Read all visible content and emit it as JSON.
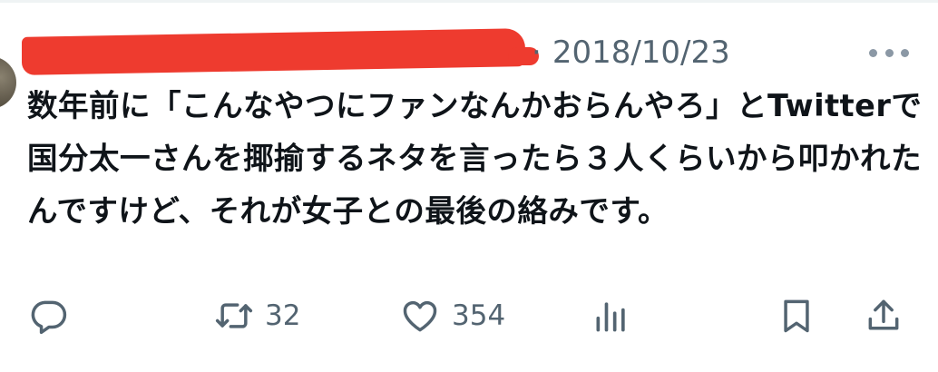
{
  "tweet": {
    "date": "2018/10/23",
    "separator": "·",
    "text": "数年前に「こんなやつにファンなんかおらんやろ」とTwitterで国分太一さんを揶揄するネタを言ったら３人くらいから叩かれたんですけど、それが女子との最後の絡みです。"
  },
  "actions": {
    "reply": {
      "icon": "reply-icon"
    },
    "retweet": {
      "icon": "retweet-icon",
      "count": "32"
    },
    "like": {
      "icon": "heart-icon",
      "count": "354"
    },
    "views": {
      "icon": "views-icon"
    },
    "bookmark": {
      "icon": "bookmark-icon"
    },
    "share": {
      "icon": "share-icon"
    }
  },
  "colors": {
    "redaction": "#ee3b2f",
    "text": "#0f1419",
    "muted": "#536471"
  }
}
